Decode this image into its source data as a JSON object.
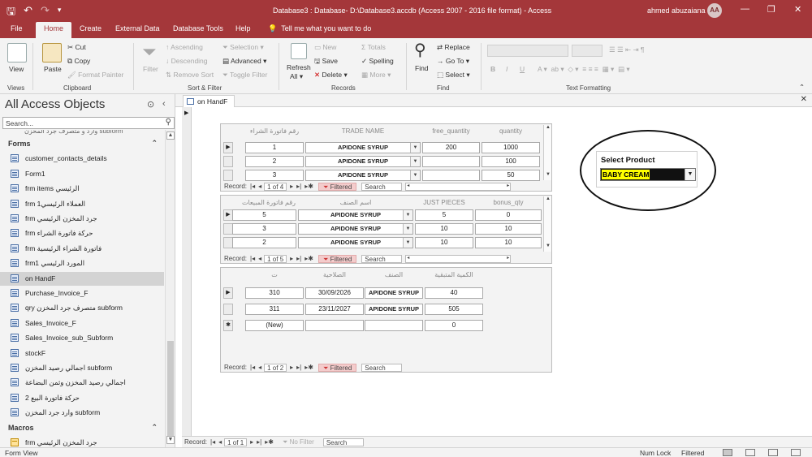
{
  "window": {
    "title": "Database3 : Database- D:\\Database3.accdb (Access 2007 - 2016 file format)  -  Access",
    "user": "ahmed abuzaiana",
    "avatar_initials": "AA",
    "min": "—",
    "max": "❐",
    "close": "✕"
  },
  "ribbon_tabs": [
    "File",
    "Home",
    "Create",
    "External Data",
    "Database Tools",
    "Help"
  ],
  "tell_me": "Tell me what you want to do",
  "ribbon": {
    "views": {
      "label": "Views",
      "view": "View"
    },
    "clipboard": {
      "label": "Clipboard",
      "paste": "Paste",
      "cut": "Cut",
      "copy": "Copy",
      "format_painter": "Format Painter"
    },
    "sort_filter": {
      "label": "Sort & Filter",
      "filter": "Filter",
      "ascending": "Ascending",
      "descending": "Descending",
      "remove_sort": "Remove Sort",
      "selection": "Selection",
      "advanced": "Advanced",
      "toggle_filter": "Toggle Filter"
    },
    "records": {
      "label": "Records",
      "refresh": "Refresh",
      "refresh2": "All",
      "new": "New",
      "save": "Save",
      "delete": "Delete",
      "totals": "Totals",
      "spelling": "Spelling",
      "more": "More"
    },
    "find": {
      "label": "Find",
      "find": "Find",
      "replace": "Replace",
      "goto": "Go To",
      "select": "Select"
    },
    "text_formatting": {
      "label": "Text Formatting",
      "b": "B",
      "i": "I",
      "u": "U"
    }
  },
  "nav": {
    "title": "All Access Objects",
    "search_placeholder": "Search...",
    "clipped_item": "وارد و متصرف جرد المحزن subform",
    "forms_section": "Forms",
    "forms": [
      "customer_contacts_details",
      "Form1",
      "frm items الرئيسي",
      "frm العملاء الرئيسي1",
      "frm جرد المخزن الرئيسي",
      "frm حركة فاتورة الشراء",
      "frm فاتورة الشراء الرئيسية",
      "frm1 المورد الرئيسي",
      "on HandF",
      "Purchase_Invoice_F",
      "qry متصرف جرد المخزن subform",
      "Sales_Invoice_F",
      "Sales_Invoice_sub_Subform",
      "stockF",
      "اجمالي رصيد المخزن subform",
      "اجمالي رصيد المخزن وثمن البضاعة",
      "حركة فاتورة البيع 2",
      "وارد جرد المخزن subform"
    ],
    "selected_form_index": 8,
    "macros_section": "Macros",
    "macros": [
      "frm جرد المخزن الرئيسي"
    ]
  },
  "document": {
    "tab": "on HandF",
    "close": "✕"
  },
  "subform1": {
    "headers": [
      "رقم فاتورة الشراء",
      "TRADE NAME",
      "free_quantity",
      "quantity"
    ],
    "rows": [
      [
        "1",
        "APIDONE SYRUP",
        "200",
        "1000"
      ],
      [
        "2",
        "APIDONE SYRUP",
        "",
        "100"
      ],
      [
        "3",
        "APIDONE SYRUP",
        "",
        "50"
      ]
    ],
    "nav": {
      "record": "Record:",
      "count": "1 of 4",
      "filtered": "Filtered",
      "search": "Search"
    }
  },
  "subform2": {
    "headers": [
      "رقم فاتورة المبيعات",
      "اسم الصنف",
      "JUST PIECES",
      "bonus_qty"
    ],
    "rows": [
      [
        "5",
        "APIDONE SYRUP",
        "5",
        "0"
      ],
      [
        "3",
        "APIDONE SYRUP",
        "10",
        "10"
      ],
      [
        "2",
        "APIDONE SYRUP",
        "10",
        "10"
      ]
    ],
    "nav": {
      "record": "Record:",
      "count": "1 of 5",
      "filtered": "Filtered",
      "search": "Search"
    }
  },
  "subform3": {
    "headers": [
      "ت",
      "الصلاحية",
      "الصنف",
      "الكمية المتبقية"
    ],
    "rows": [
      [
        "310",
        "30/09/2026",
        "APIDONE SYRUP",
        "40"
      ],
      [
        "311",
        "23/11/2027",
        "APIDONE SYRUP",
        "505"
      ]
    ],
    "new_row": [
      "(New)",
      "",
      "",
      "0"
    ],
    "nav": {
      "record": "Record:",
      "count": "1 of 2",
      "filtered": "Filtered",
      "search": "Search"
    }
  },
  "select_product": {
    "label": "Select Product",
    "value": "BABY CREAM"
  },
  "outer_nav": {
    "record": "Record:",
    "count": "1 of 1",
    "no_filter": "No Filter",
    "search": "Search"
  },
  "status": {
    "left": "Form View",
    "num_lock": "Num Lock",
    "filtered": "Filtered"
  },
  "colors": {
    "accent": "#a4373a",
    "highlight": "#ffff00",
    "filtered_bg": "#f4cccc"
  }
}
